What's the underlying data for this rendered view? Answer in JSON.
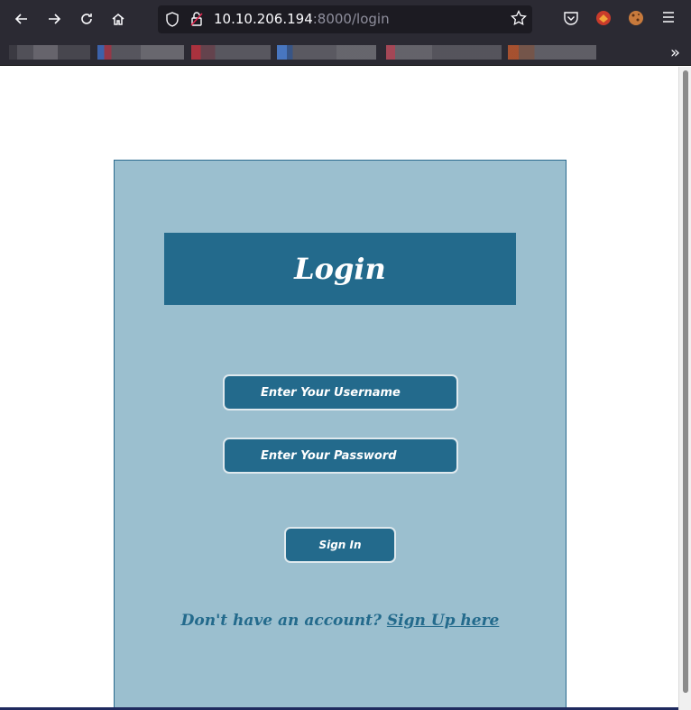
{
  "browser": {
    "url_host": "10.10.206.194",
    "url_rest": ":8000/login",
    "icons": [
      "back-icon",
      "forward-icon",
      "reload-icon",
      "home-icon",
      "shield-icon",
      "lock-icon",
      "star-icon",
      "pocket-icon",
      "extension-icon",
      "cookie-icon",
      "menu-icon",
      "overflow-chevron-icon"
    ]
  },
  "login": {
    "title": "Login",
    "username_placeholder": "Enter Your Username",
    "password_placeholder": "Enter Your Password",
    "signin_label": "Sign In",
    "no_account_text": "Don't have an account?",
    "signup_link": "Sign Up here"
  },
  "colors": {
    "card_bg": "#9bbfcf",
    "accent": "#236a8c",
    "chrome_bg": "#2b2a33"
  }
}
